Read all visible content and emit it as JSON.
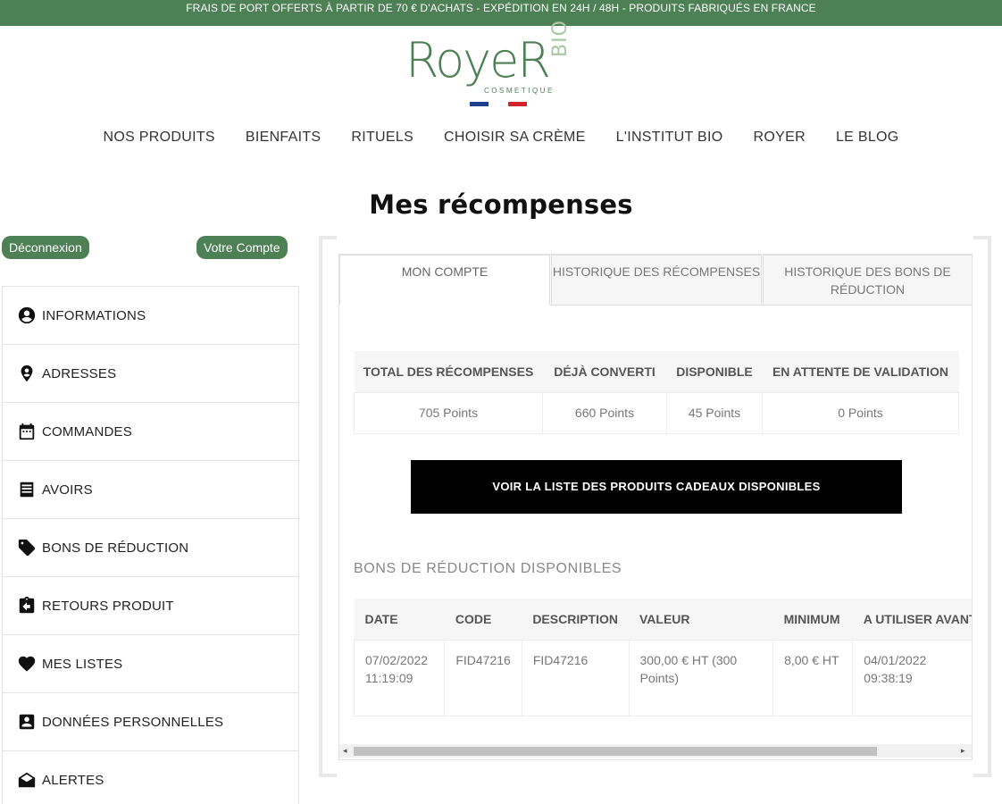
{
  "topbar": {
    "text": "FRAIS DE PORT OFFERTS À PARTIR DE 70 € D'ACHATS - EXPÉDITION EN 24H / 48H - PRODUITS FABRIQUÉS EN FRANCE"
  },
  "logo": {
    "word": "RoyeR",
    "bio": "BIO",
    "sub": "COSMETIQUE"
  },
  "colors": {
    "brand": "#4e8055",
    "brand_light": "#a9c7a3",
    "flag_blue": "#1f3f8f",
    "flag_white": "#ffffff",
    "flag_red": "#d3242b"
  },
  "nav": [
    "NOS PRODUITS",
    "BIENFAITS",
    "RITUELS",
    "CHOISIR SA CRÈME",
    "L'INSTITUT BIO",
    "ROYER",
    "LE BLOG"
  ],
  "page": {
    "title": "Mes récompenses"
  },
  "buttons": {
    "logout": "Déconnexion",
    "account": "Votre Compte",
    "gift_list": "VOIR LA LISTE DES PRODUITS CADEAUX DISPONIBLES"
  },
  "sidebar": [
    {
      "label": "INFORMATIONS",
      "icon": "user-circle-icon"
    },
    {
      "label": "ADRESSES",
      "icon": "location-pin-icon"
    },
    {
      "label": "COMMANDES",
      "icon": "calendar-icon"
    },
    {
      "label": "AVOIRS",
      "icon": "receipt-icon"
    },
    {
      "label": "BONS DE RÉDUCTION",
      "icon": "tag-icon"
    },
    {
      "label": "RETOURS PRODUIT",
      "icon": "clipboard-return-icon"
    },
    {
      "label": "MES LISTES",
      "icon": "heart-icon"
    },
    {
      "label": "DONNÉES PERSONNELLES",
      "icon": "id-card-icon"
    },
    {
      "label": "ALERTES",
      "icon": "envelope-open-icon"
    }
  ],
  "tabs": [
    {
      "label": "MON COMPTE",
      "active": true
    },
    {
      "label": "HISTORIQUE DES RÉCOMPENSES",
      "active": false
    },
    {
      "label": "HISTORIQUE DES BONS DE RÉDUCTION",
      "active": false
    }
  ],
  "summary": {
    "headers": [
      "TOTAL DES RÉCOMPENSES",
      "DÉJÀ CONVERTI",
      "DISPONIBLE",
      "EN ATTENTE DE VALIDATION"
    ],
    "values": [
      "705 Points",
      "660 Points",
      "45 Points",
      "0 Points"
    ]
  },
  "vouchers": {
    "title": "BONS DE RÉDUCTION DISPONIBLES",
    "headers": [
      "DATE",
      "CODE",
      "DESCRIPTION",
      "VALEUR",
      "MINIMUM",
      "A UTILISER AVANT"
    ],
    "rows": [
      {
        "date": "07/02/2022 11:19:09",
        "code": "FID47216",
        "description": "FID47216",
        "value": "300,00 € HT (300 Points)",
        "minimum": "8,00 € HT",
        "expiry": "04/01/2022 09:38:19"
      }
    ]
  }
}
